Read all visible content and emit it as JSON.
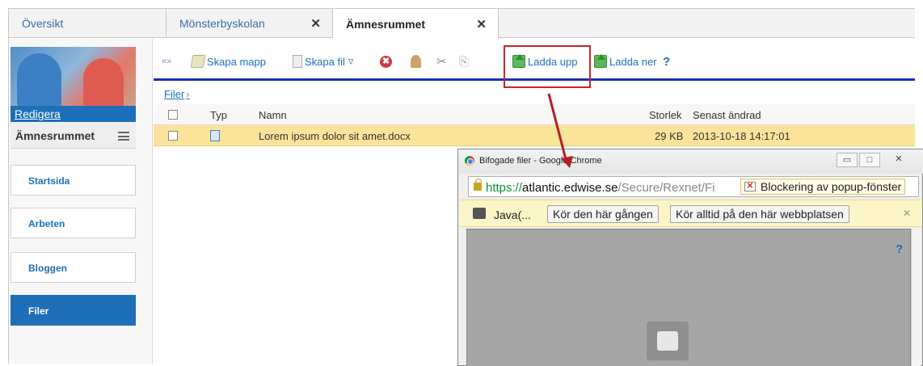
{
  "tabs": [
    {
      "label": "Översikt",
      "closable": false,
      "active": false
    },
    {
      "label": "Mönsterbyskolan",
      "closable": true,
      "active": false
    },
    {
      "label": "Ämnesrummet",
      "closable": true,
      "active": true
    }
  ],
  "tab_close_glyph": "✕",
  "sidebar": {
    "edit_link": "Redigera",
    "room_name": "Ämnesrummet",
    "items": [
      {
        "label": "Startsida",
        "active": false
      },
      {
        "label": "Arbeten",
        "active": false
      },
      {
        "label": "Bloggen",
        "active": false
      },
      {
        "label": "Filer",
        "active": true
      }
    ]
  },
  "toolbar": {
    "collapse": "«»",
    "new_folder": "Skapa mapp",
    "new_file": "Skapa fil",
    "new_file_arrow": "▿",
    "delete_glyph": "✖",
    "cut_glyph": "✂",
    "copy_glyph": "⎘",
    "upload": "Ladda upp",
    "download": "Ladda ner",
    "help": "?"
  },
  "breadcrumb": {
    "root": "Filer",
    "separator": "›"
  },
  "file_list": {
    "columns": {
      "type": "Typ",
      "name": "Namn",
      "size": "Storlek",
      "modified": "Senast ändrad"
    },
    "rows": [
      {
        "name": "Lorem ipsum dolor sit amet.docx",
        "size": "29 KB",
        "modified": "2013-10-18 14:17:01"
      }
    ]
  },
  "popup": {
    "title": "Bifogade filer - Google Chrome",
    "win_minimize": "▭",
    "win_maximize": "□",
    "win_close": "✕",
    "url_scheme": "https://",
    "url_host": "atlantic.edwise.se",
    "url_path": "/Secure/Rexnet/Fi",
    "popup_blocked": "Blockering av popup-fönster",
    "infobar": {
      "plugin_label": "Java(...",
      "run_once": "Kör den här gången",
      "always_run": "Kör alltid på den här webbplatsen",
      "close": "✕"
    },
    "help": "?"
  },
  "colors": {
    "accent": "#1d6fb8",
    "highlight_row": "#fbe49a",
    "annotation_red": "#c8242c",
    "toolbar_rule": "#1b2fb8"
  }
}
